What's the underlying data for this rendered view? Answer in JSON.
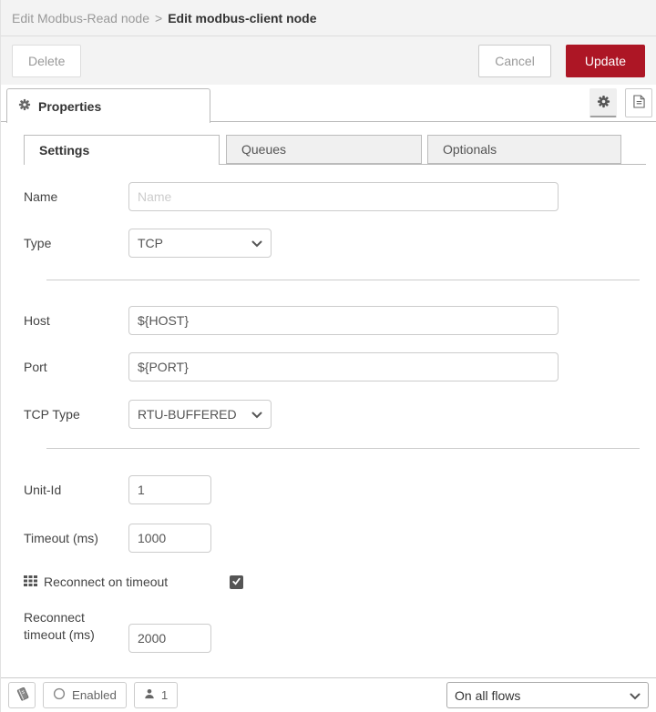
{
  "header": {
    "breadcrumb": {
      "parent": "Edit Modbus-Read node",
      "separator": ">",
      "current": "Edit modbus-client node"
    }
  },
  "toolbar": {
    "delete_label": "Delete",
    "cancel_label": "Cancel",
    "update_label": "Update"
  },
  "panel": {
    "title": "Properties"
  },
  "tabs": [
    {
      "label": "Settings",
      "active": true
    },
    {
      "label": "Queues",
      "active": false
    },
    {
      "label": "Optionals",
      "active": false
    }
  ],
  "form": {
    "name": {
      "label": "Name",
      "placeholder": "Name",
      "value": ""
    },
    "type": {
      "label": "Type",
      "value": "TCP"
    },
    "host": {
      "label": "Host",
      "value": "${HOST}"
    },
    "port": {
      "label": "Port",
      "value": "${PORT}"
    },
    "tcp_type": {
      "label": "TCP Type",
      "value": "RTU-BUFFERED"
    },
    "unit_id": {
      "label": "Unit-Id",
      "value": "1"
    },
    "timeout": {
      "label": "Timeout (ms)",
      "value": "1000"
    },
    "reconnect_on_timeout": {
      "label": "Reconnect on timeout",
      "checked": true
    },
    "reconnect_timeout": {
      "label": "Reconnect timeout (ms)",
      "value": "2000"
    }
  },
  "footer": {
    "enabled_label": "Enabled",
    "instance_count": "1",
    "deploy_scope": "On all flows"
  },
  "colors": {
    "update_button": "#ad1625",
    "bar_background": "#f3f3f3",
    "tab_border": "#bbbbbb"
  }
}
